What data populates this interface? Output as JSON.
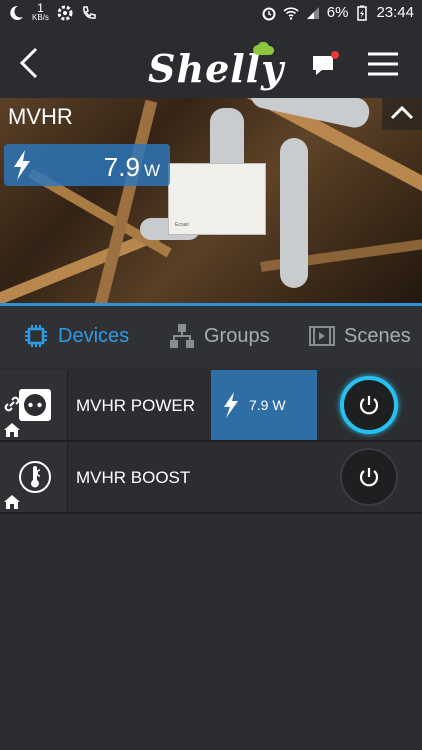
{
  "status_bar": {
    "speed_value": "1",
    "speed_unit": "KB/s",
    "battery": "6%",
    "time": "23:44"
  },
  "header": {
    "logo_text": "Shelly"
  },
  "hero": {
    "title": "MVHR",
    "power_value": "7.9",
    "power_unit": "W",
    "unit_brand": "Ecoair"
  },
  "tabs": [
    {
      "label": "Devices",
      "icon": "chip-icon",
      "active": true
    },
    {
      "label": "Groups",
      "icon": "groups-icon",
      "active": false
    },
    {
      "label": "Scenes",
      "icon": "film-icon",
      "active": false
    }
  ],
  "devices": [
    {
      "name": "MVHR POWER",
      "power": "7.9 W",
      "state": "on",
      "icon": "plug-icon"
    },
    {
      "name": "MVHR BOOST",
      "state": "off",
      "icon": "thermometer-icon"
    }
  ],
  "colors": {
    "accent": "#2f9ae6",
    "power_bg": "#2d6fa4",
    "toggle_on": "#28c0f0",
    "background": "#2b2d30"
  }
}
